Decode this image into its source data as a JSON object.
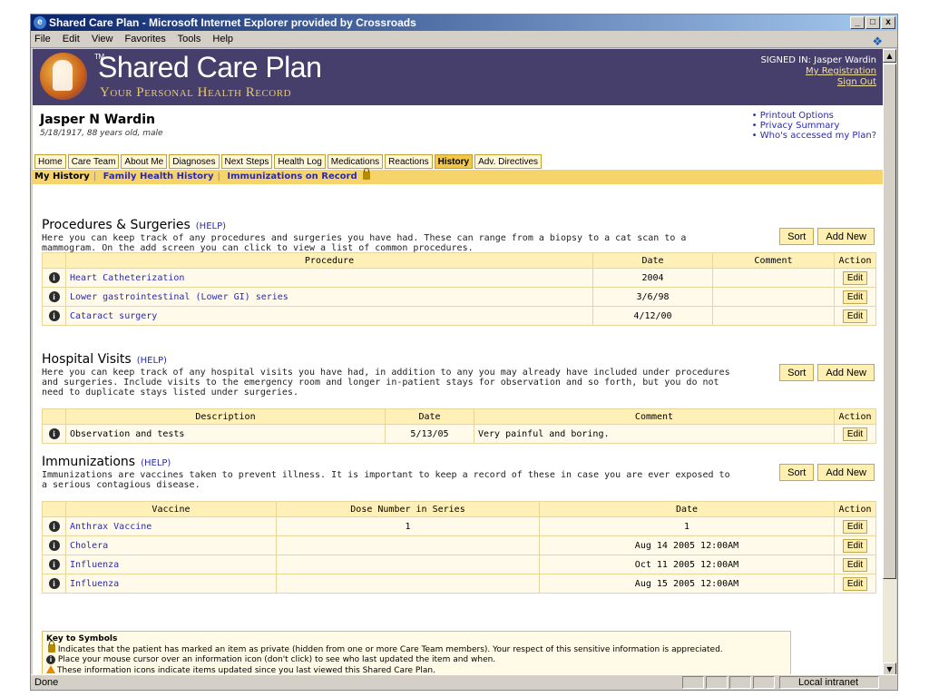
{
  "window": {
    "title": "Shared Care Plan - Microsoft Internet Explorer provided by Crossroads",
    "buttons": [
      "_",
      "□",
      "x"
    ]
  },
  "menubar": [
    "File",
    "Edit",
    "View",
    "Favorites",
    "Tools",
    "Help"
  ],
  "banner": {
    "brand": "Shared Care Plan",
    "tagline": "Your Personal Health Record",
    "signed_in_label": "SIGNED IN: Jasper Wardin",
    "my_registration": "My Registration",
    "sign_out": "Sign Out"
  },
  "patient": {
    "name": "Jasper N Wardin",
    "info": "5/18/1917, 88 years old, male"
  },
  "quick_links": [
    "Printout Options",
    "Privacy Summary",
    "Who's accessed my Plan?"
  ],
  "tabs": [
    "Home",
    "Care Team",
    "About Me",
    "Diagnoses",
    "Next Steps",
    "Health Log",
    "Medications",
    "Reactions",
    "History",
    "Adv. Directives"
  ],
  "active_tab": "History",
  "subnav": {
    "current": "My History",
    "family": "Family Health History",
    "immunizations": "Immunizations on Record"
  },
  "buttons": {
    "sort": "Sort",
    "add_new": "Add New",
    "edit": "Edit",
    "help": "(HELP)"
  },
  "procedures": {
    "title": "Procedures & Surgeries",
    "description": "Here you can keep track of any procedures and surgeries you have had. These can range from a biopsy to a cat scan to a mammogram. On the add screen you can click to view a list of common procedures.",
    "columns": [
      "Procedure",
      "Date",
      "Comment",
      "Action"
    ],
    "rows": [
      {
        "name": "Heart Catheterization",
        "date": "2004",
        "comment": ""
      },
      {
        "name": "Lower gastrointestinal (Lower GI) series",
        "date": "3/6/98",
        "comment": ""
      },
      {
        "name": "Cataract surgery",
        "date": "4/12/00",
        "comment": ""
      }
    ]
  },
  "hospital": {
    "title": "Hospital Visits",
    "description": "Here you can keep track of any hospital visits you have had, in addition to any you may already have included under procedures and surgeries. Include visits to the emergency room and longer in-patient stays for observation and so forth, but you do not need to duplicate stays listed under surgeries.",
    "columns": [
      "Description",
      "Date",
      "Comment",
      "Action"
    ],
    "rows": [
      {
        "name": "Observation and tests",
        "date": "5/13/05",
        "comment": "Very painful and boring."
      }
    ]
  },
  "immunizations": {
    "title": "Immunizations",
    "description": "Immunizations are vaccines taken to prevent illness. It is important to keep a record of these in case you are ever exposed to a serious contagious disease.",
    "columns": [
      "Vaccine",
      "Dose Number in Series",
      "Date",
      "Action"
    ],
    "rows": [
      {
        "name": "Anthrax Vaccine",
        "dose": "1",
        "date": "1"
      },
      {
        "name": "Cholera",
        "dose": "",
        "date": "Aug 14 2005 12:00AM"
      },
      {
        "name": "Influenza",
        "dose": "",
        "date": "Oct 11 2005 12:00AM"
      },
      {
        "name": "Influenza",
        "dose": "",
        "date": "Aug 15 2005 12:00AM"
      }
    ]
  },
  "key": {
    "title": "Key to Symbols",
    "lines": [
      "Indicates that the patient has marked an item as private (hidden from one or more Care Team members). Your respect of this sensitive information is appreciated.",
      "Place your mouse cursor over an information icon (don't click) to see who last updated the item and when.",
      "These information icons indicate items updated since you last viewed this Shared Care Plan."
    ]
  },
  "status": {
    "left": "Done",
    "zone": "Local intranet"
  },
  "icons": {
    "info": "info-icon",
    "lock": "lock-icon",
    "warning": "warning-icon"
  }
}
